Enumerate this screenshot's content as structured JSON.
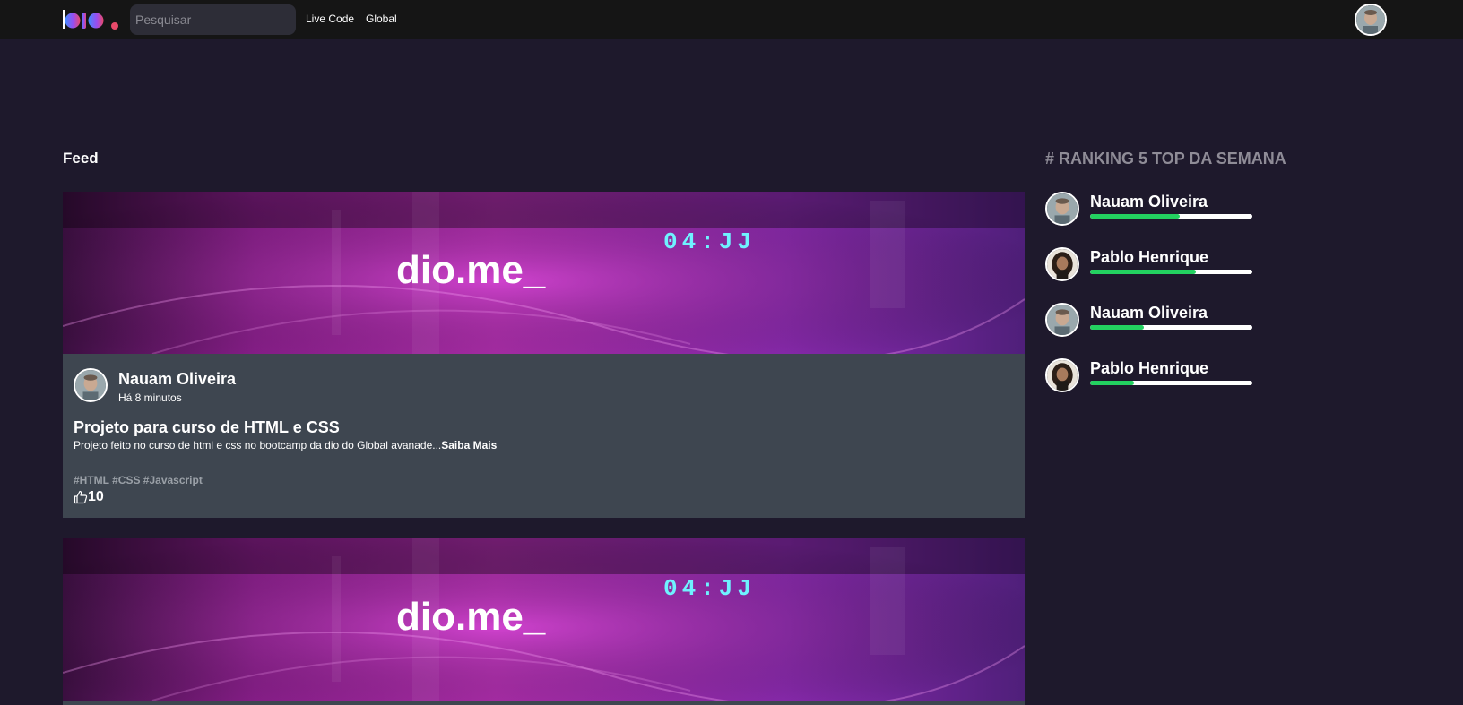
{
  "header": {
    "logo_text": "dio.",
    "search_placeholder": "Pesquisar",
    "nav": [
      {
        "label": "Live Code"
      },
      {
        "label": "Global"
      }
    ]
  },
  "feed": {
    "title": "Feed",
    "banner_text": "dio.me_",
    "banner_timer": "04:JJ",
    "posts": [
      {
        "author": "Nauam Oliveira",
        "time": "Há 8 minutos",
        "title": "Projeto para curso de HTML e CSS",
        "description": "Projeto feito no curso de html e css no bootcamp da dio do Global avanade...",
        "more_label": "Saiba Mais",
        "tags": "#HTML #CSS #Javascript",
        "likes": "10"
      }
    ]
  },
  "ranking": {
    "title": "# RANKING 5 TOP DA SEMANA",
    "items": [
      {
        "name": "Nauam Oliveira",
        "progress": 0.55
      },
      {
        "name": "Pablo Henrique",
        "progress": 0.65
      },
      {
        "name": "Nauam Oliveira",
        "progress": 0.33
      },
      {
        "name": "Pablo Henrique",
        "progress": 0.27
      }
    ]
  },
  "colors": {
    "background": "#1e192c",
    "header": "#151515",
    "card_body": "#3e4650",
    "progress": "#23d160",
    "accent_logo_dot": "#e84a6a"
  }
}
